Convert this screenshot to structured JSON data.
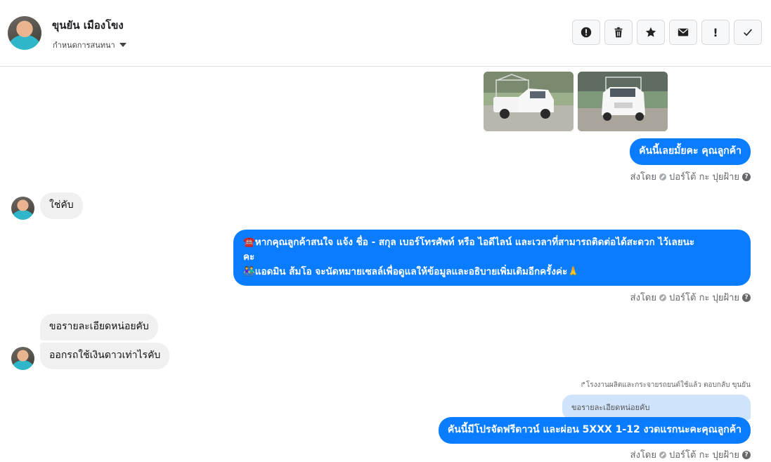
{
  "header": {
    "contact_name": "ขุนยัน เมืองโขง",
    "assign_label": "กำหนดการสนทนา",
    "toolbar": [
      {
        "name": "spam-button",
        "icon": "alert-circle-icon"
      },
      {
        "name": "delete-button",
        "icon": "trash-icon"
      },
      {
        "name": "star-button",
        "icon": "star-icon"
      },
      {
        "name": "mark-unread-button",
        "icon": "envelope-icon"
      },
      {
        "name": "important-button",
        "icon": "exclamation-icon",
        "label": "!"
      },
      {
        "name": "done-button",
        "icon": "check-icon"
      }
    ]
  },
  "messages": {
    "m1": {
      "text": "คันนี้เลยมั้ยคะ คุณลูกค้า"
    },
    "m1_meta": {
      "sent_by": "ส่งโดย",
      "sender": "ปอร์โต้ กะ ปุยฝ้าย"
    },
    "m2": {
      "text": "ใช่คับ"
    },
    "m3": {
      "line1": "☎️หากคุณลูกค้าสนใจ แจ้ง ชื่อ - สกุล เบอร์โทรศัพท์ หรือ ไอดีไลน์ และเวลาที่สามารถติดต่อได้สะดวก ไว้เลยนะ",
      "line2": "คะ",
      "line3": "👫แอดมิน ส้มโอ จะนัดหมายเซลล์เพื่อดูแลให้ข้อมูลและอธิบายเพิ่มเติมอีกครั้งค่ะ🙏"
    },
    "m3_meta": {
      "sent_by": "ส่งโดย",
      "sender": "ปอร์โต้ กะ ปุยฝ้าย"
    },
    "m4": {
      "text": "ขอรายละเอียดหน่อยคับ"
    },
    "m5": {
      "text": "ออกรถใช้เงินดาวเท่าไรคับ"
    },
    "reply_label": "↱โรงงานผลิตและกระจายรถยนต์ใช้แล้ว ตอบกลับ ขุนยัน",
    "quoted": "ขอรายละเอียดหน่อยคับ",
    "m6": {
      "text": "คันนี้มีโปรจัดฟรีดาวน์ และผ่อน 5XXX  1-12 งวดแรกนะคะคุณลูกค้า"
    },
    "m6_meta": {
      "sent_by": "ส่งโดย",
      "sender": "ปอร์โต้ กะ ปุยฝ้าย"
    }
  },
  "colors": {
    "outgoing": "#0a7cff",
    "incoming": "#f0f0f0",
    "quoted": "#cfe3fb"
  }
}
